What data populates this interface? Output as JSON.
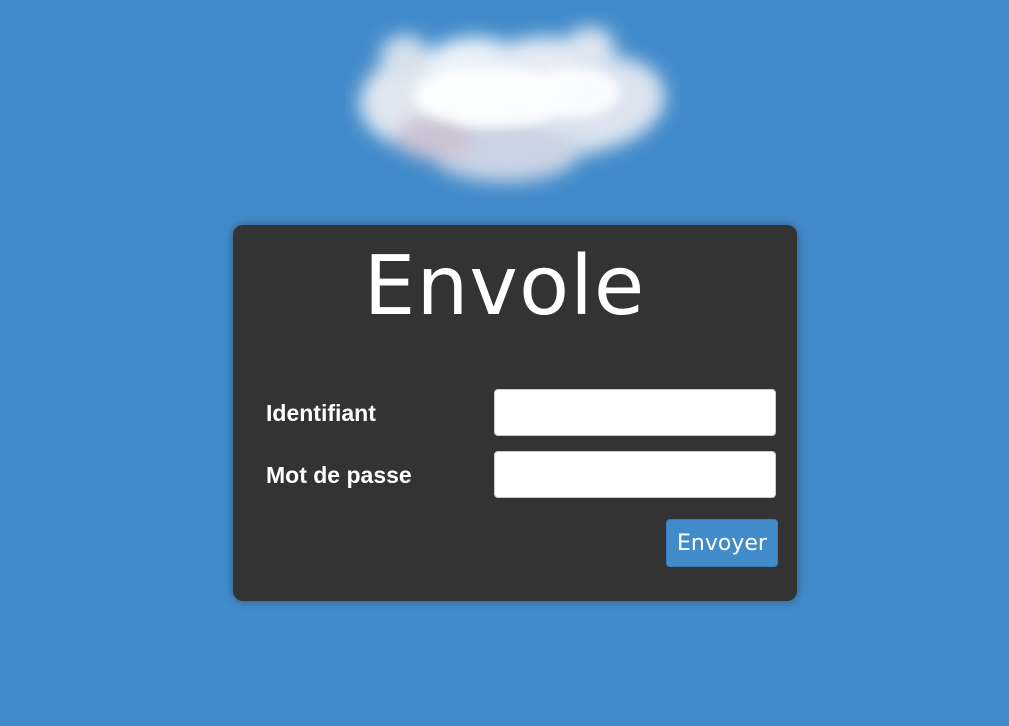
{
  "background_color": "#428bca",
  "panel_color": "#333333",
  "cloud": {
    "icon": "cloud-icon"
  },
  "login": {
    "title": "Envole",
    "username_label": "Identifiant",
    "username_value": "",
    "password_label": "Mot de passe",
    "password_value": "",
    "submit_label": "Envoyer"
  }
}
